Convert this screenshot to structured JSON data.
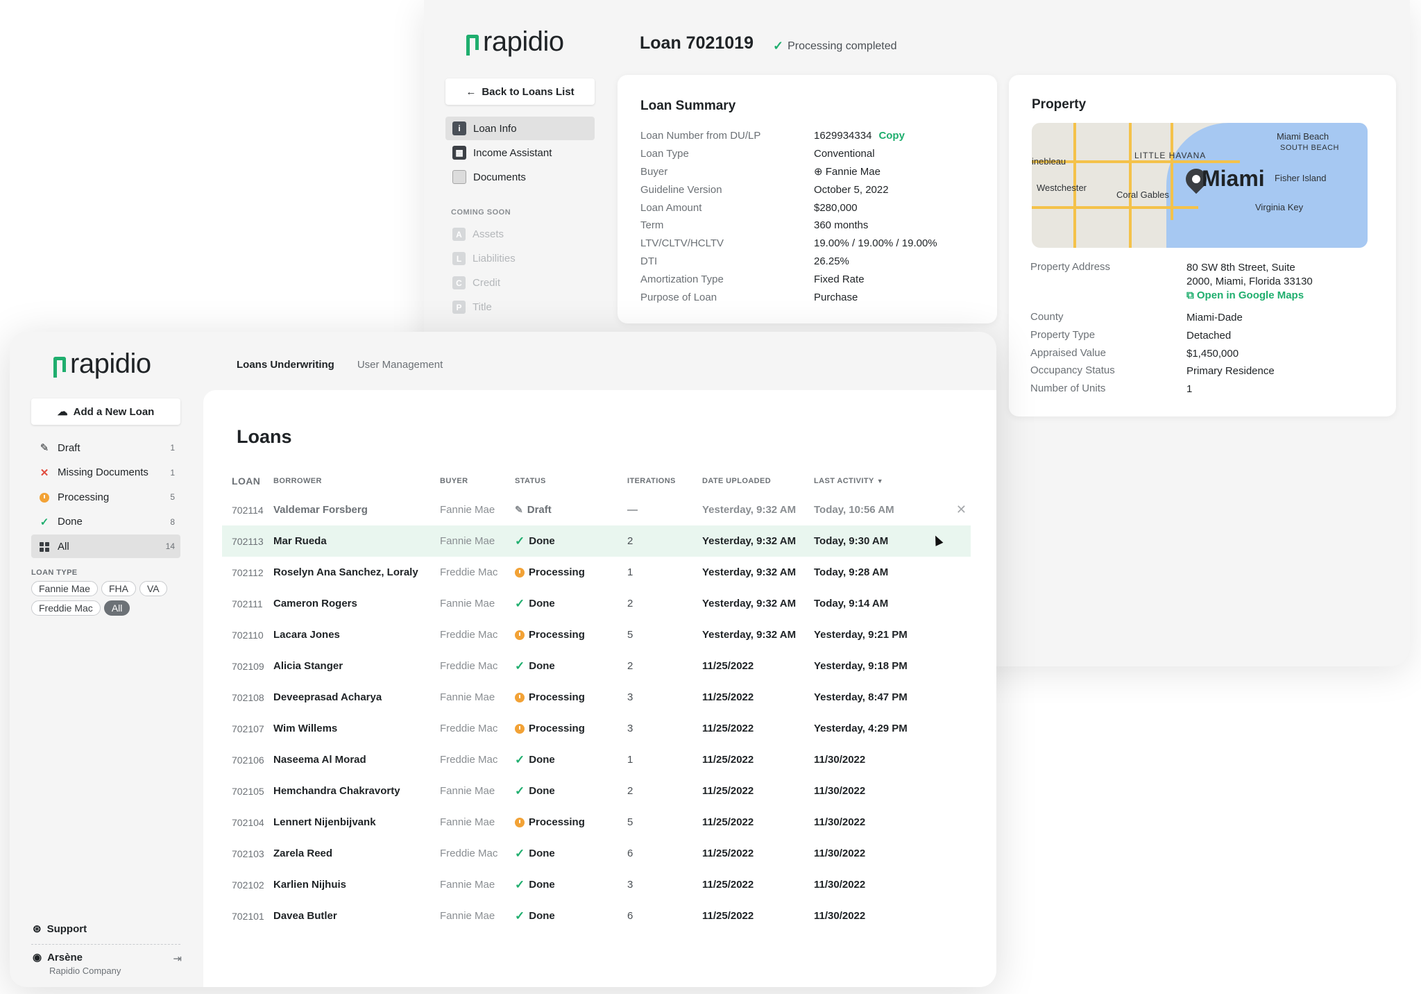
{
  "brand": {
    "name": "rapidio",
    "color": "#1fae6e"
  },
  "detail": {
    "title": "Loan 7021019",
    "status": "Processing completed",
    "back_label": "Back to Loans List",
    "nav": [
      {
        "label": "Loan Info",
        "icon": "info-icon"
      },
      {
        "label": "Income Assistant",
        "icon": "calculator-icon"
      },
      {
        "label": "Documents",
        "icon": "document-icon"
      }
    ],
    "coming_soon_label": "COMING SOON",
    "coming_soon": [
      {
        "letter": "A",
        "label": "Assets"
      },
      {
        "letter": "L",
        "label": "Liabilities"
      },
      {
        "letter": "C",
        "label": "Credit"
      },
      {
        "letter": "P",
        "label": "Title"
      }
    ],
    "summary": {
      "title": "Loan Summary",
      "copy_label": "Copy",
      "rows": [
        {
          "key": "Loan Number from DU/LP",
          "value": "1629934334"
        },
        {
          "key": "Loan Type",
          "value": "Conventional"
        },
        {
          "key": "Buyer",
          "value": "Fannie Mae"
        },
        {
          "key": "Guideline Version",
          "value": "October 5, 2022"
        },
        {
          "key": "Loan Amount",
          "value": "$280,000"
        },
        {
          "key": "Term",
          "value": "360 months"
        },
        {
          "key": "LTV/CLTV/HCLTV",
          "value": "19.00% / 19.00% / 19.00%"
        },
        {
          "key": "DTI",
          "value": "26.25%"
        },
        {
          "key": "Amortization Type",
          "value": "Fixed Rate"
        },
        {
          "key": "Purpose of Loan",
          "value": "Purchase"
        }
      ]
    },
    "property": {
      "title": "Property",
      "map_labels": {
        "miami": "Miami",
        "miami_beach": "Miami Beach",
        "south_beach": "SOUTH BEACH",
        "little_havana": "LITTLE HAVANA",
        "fisher_island": "Fisher Island",
        "westchester": "Westchester",
        "coral_gables": "Coral Gables",
        "virginia_key": "Virginia Key",
        "fontainebleau": "inebleau"
      },
      "address_key": "Property Address",
      "address_line1": "80 SW 8th Street, Suite",
      "address_line2": "2000, Miami, Florida 33130",
      "maps_link": "Open in Google Maps",
      "rows": [
        {
          "key": "County",
          "value": "Miami-Dade"
        },
        {
          "key": "Property Type",
          "value": "Detached"
        },
        {
          "key": "Appraised Value",
          "value": "$1,450,000"
        },
        {
          "key": "Occupancy Status",
          "value": "Primary Residence"
        },
        {
          "key": "Number of Units",
          "value": "1"
        }
      ]
    }
  },
  "main": {
    "tabs": [
      {
        "label": "Loans Underwriting",
        "active": true
      },
      {
        "label": "User Management",
        "active": false
      }
    ],
    "add_button": "Add a New Loan",
    "filters": [
      {
        "label": "Draft",
        "count": "1",
        "icon": "pencil-icon"
      },
      {
        "label": "Missing Documents",
        "count": "1",
        "icon": "x-icon"
      },
      {
        "label": "Processing",
        "count": "5",
        "icon": "clock-icon"
      },
      {
        "label": "Done",
        "count": "8",
        "icon": "check-icon"
      },
      {
        "label": "All",
        "count": "14",
        "icon": "grid-icon"
      }
    ],
    "loan_type_label": "LOAN TYPE",
    "loan_types": [
      "Fannie Mae",
      "FHA",
      "VA",
      "Freddie Mac",
      "All"
    ],
    "support": "Support",
    "user_name": "Arsène",
    "user_company": "Rapidio Company",
    "page_title": "Loans",
    "columns": [
      "LOAN",
      "BORROWER",
      "BUYER",
      "STATUS",
      "ITERATIONS",
      "DATE UPLOADED",
      "LAST ACTIVITY"
    ],
    "rows": [
      {
        "loan": "702114",
        "borrower": "Valdemar Forsberg",
        "buyer": "Fannie Mae",
        "status": "Draft",
        "iterations": "—",
        "uploaded": "Yesterday, 9:32 AM",
        "activity": "Today, 10:56 AM"
      },
      {
        "loan": "702113",
        "borrower": "Mar Rueda",
        "buyer": "Fannie Mae",
        "status": "Done",
        "iterations": "2",
        "uploaded": "Yesterday, 9:32 AM",
        "activity": "Today, 9:30 AM"
      },
      {
        "loan": "702112",
        "borrower": "Roselyn Ana Sanchez, Loraly",
        "buyer": "Freddie Mac",
        "status": "Processing",
        "iterations": "1",
        "uploaded": "Yesterday, 9:32 AM",
        "activity": "Today, 9:28 AM"
      },
      {
        "loan": "702111",
        "borrower": "Cameron Rogers",
        "buyer": "Fannie Mae",
        "status": "Done",
        "iterations": "2",
        "uploaded": "Yesterday, 9:32 AM",
        "activity": "Today, 9:14 AM"
      },
      {
        "loan": "702110",
        "borrower": "Lacara Jones",
        "buyer": "Freddie Mac",
        "status": "Processing",
        "iterations": "5",
        "uploaded": "Yesterday, 9:32 AM",
        "activity": "Yesterday, 9:21 PM"
      },
      {
        "loan": "702109",
        "borrower": "Alicia Stanger",
        "buyer": "Freddie Mac",
        "status": "Done",
        "iterations": "2",
        "uploaded": "11/25/2022",
        "activity": "Yesterday, 9:18 PM"
      },
      {
        "loan": "702108",
        "borrower": "Deveeprasad Acharya",
        "buyer": "Fannie Mae",
        "status": "Processing",
        "iterations": "3",
        "uploaded": "11/25/2022",
        "activity": "Yesterday, 8:47 PM"
      },
      {
        "loan": "702107",
        "borrower": "Wim Willems",
        "buyer": "Freddie Mac",
        "status": "Processing",
        "iterations": "3",
        "uploaded": "11/25/2022",
        "activity": "Yesterday, 4:29 PM"
      },
      {
        "loan": "702106",
        "borrower": "Naseema Al Morad",
        "buyer": "Freddie Mac",
        "status": "Done",
        "iterations": "1",
        "uploaded": "11/25/2022",
        "activity": "11/30/2022"
      },
      {
        "loan": "702105",
        "borrower": "Hemchandra Chakravorty",
        "buyer": "Fannie Mae",
        "status": "Done",
        "iterations": "2",
        "uploaded": "11/25/2022",
        "activity": "11/30/2022"
      },
      {
        "loan": "702104",
        "borrower": "Lennert Nijenbijvank",
        "buyer": "Fannie Mae",
        "status": "Processing",
        "iterations": "5",
        "uploaded": "11/25/2022",
        "activity": "11/30/2022"
      },
      {
        "loan": "702103",
        "borrower": "Zarela Reed",
        "buyer": "Freddie Mac",
        "status": "Done",
        "iterations": "6",
        "uploaded": "11/25/2022",
        "activity": "11/30/2022"
      },
      {
        "loan": "702102",
        "borrower": "Karlien Nijhuis",
        "buyer": "Fannie Mae",
        "status": "Done",
        "iterations": "3",
        "uploaded": "11/25/2022",
        "activity": "11/30/2022"
      },
      {
        "loan": "702101",
        "borrower": "Davea Butler",
        "buyer": "Fannie Mae",
        "status": "Done",
        "iterations": "6",
        "uploaded": "11/25/2022",
        "activity": "11/30/2022"
      }
    ]
  }
}
